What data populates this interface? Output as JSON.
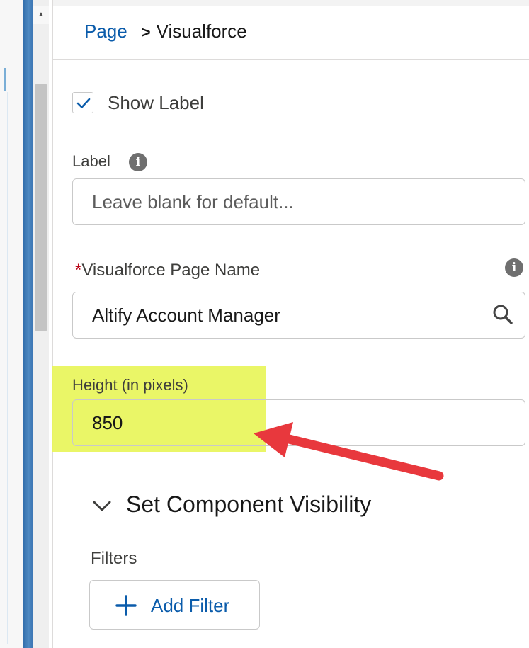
{
  "header": {
    "breadcrumb_root": "Page",
    "breadcrumb_separator": ">",
    "breadcrumb_current": "Visualforce"
  },
  "show_label": {
    "label": "Show Label",
    "checked": true
  },
  "label_field": {
    "label": "Label",
    "value": "",
    "placeholder": "Leave blank for default..."
  },
  "page_name_field": {
    "required_marker": "*",
    "label": "Visualforce Page Name",
    "value": "Altify Account Manager"
  },
  "height_field": {
    "label": "Height (in pixels)",
    "value": "850"
  },
  "visibility_section": {
    "title": "Set Component Visibility",
    "filters_label": "Filters",
    "add_filter_label": "Add Filter"
  },
  "icons": {
    "info": "info-icon",
    "search": "search-icon",
    "chevron": "chevron-down-icon",
    "plus": "plus-icon",
    "check": "checkmark-icon"
  },
  "colors": {
    "link_blue": "#0b5cab",
    "highlight_yellow": "#e8f55a",
    "annotation_arrow": "#e8383d",
    "required_red": "#ba0517"
  }
}
